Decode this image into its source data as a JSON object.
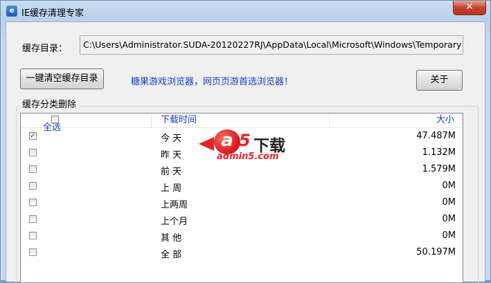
{
  "window": {
    "title": "IE缓存清理专家",
    "close_glyph": "✕"
  },
  "cache_dir": {
    "label": "缓存目录：",
    "value": "C:\\Users\\Administrator.SUDA-20120227RJ\\AppData\\Local\\Microsoft\\Windows\\Temporary In"
  },
  "buttons": {
    "clear": "一键清空缓存目录",
    "about": "关于"
  },
  "promo_text": "糖果游戏浏览器，网页页游首选浏览器！",
  "group": {
    "title": "缓存分类删除"
  },
  "list": {
    "headers": {
      "select_all": "全选",
      "time": "下载时间",
      "size": "大小"
    },
    "rows": [
      {
        "period": "今 天",
        "size": "47.487M",
        "checked": true,
        "check_glyph": "✓"
      },
      {
        "period": "昨 天",
        "size": "1.132M",
        "checked": false,
        "check_glyph": ""
      },
      {
        "period": "前 天",
        "size": "1.579M",
        "checked": false,
        "check_glyph": ""
      },
      {
        "period": "上 周",
        "size": "0M",
        "checked": false,
        "check_glyph": ""
      },
      {
        "period": "上两周",
        "size": "0M",
        "checked": false,
        "check_glyph": ""
      },
      {
        "period": "上个月",
        "size": "0M",
        "checked": false,
        "check_glyph": ""
      },
      {
        "period": "其 他",
        "size": "0M",
        "checked": false,
        "check_glyph": ""
      },
      {
        "period": "全 部",
        "size": "50.197M",
        "checked": false,
        "check_glyph": ""
      }
    ]
  },
  "watermark": {
    "letter": "a",
    "digit": "5",
    "brand": "下载",
    "domain": "admin5.com"
  },
  "colors": {
    "header_text": "#1a3cc7",
    "promo_text": "#1a3cc7",
    "watermark_red": "#e2252b"
  }
}
